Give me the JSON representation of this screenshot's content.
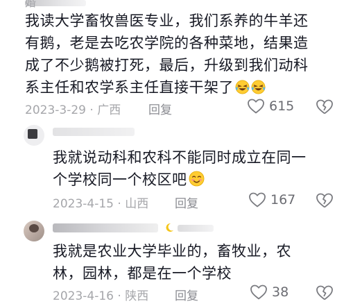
{
  "comments": [
    {
      "author_fragment": "婚",
      "text_line1": "我读大学畜牧兽医专业，我们系养的牛羊还",
      "text_line2": "有鹅，老是去吃农学院的各种菜地，结果造",
      "text_line3": "成了不少鹅被打死，最后，升级到我们动科",
      "text_line4": "系主任和农学系主任直接干架了",
      "emoji": [
        "laughing-crying-emoji",
        "laughing-crying-emoji"
      ],
      "date": "2023-3-29",
      "location": "广西",
      "reply_label": "回复",
      "likes": "615"
    },
    {
      "text_line1": "我就说动科和农科不能同时成立在同一",
      "text_line2": "个学校同一个校区吧",
      "emoji": [
        "smiling-blush-emoji"
      ],
      "date": "2023-4-15",
      "location": "山西",
      "reply_label": "回复",
      "likes": "167"
    },
    {
      "text_line1": "我就是农业大学毕业的，畜牧业，农",
      "text_line2": "林，园林，都是在一个学校",
      "date": "2023-4-16",
      "location": "陕西",
      "reply_label": "回复",
      "likes": "38"
    }
  ],
  "separator": "·",
  "colors": {
    "text": "#161823",
    "meta": "#a5a6aa",
    "reply": "#8a8b91"
  }
}
